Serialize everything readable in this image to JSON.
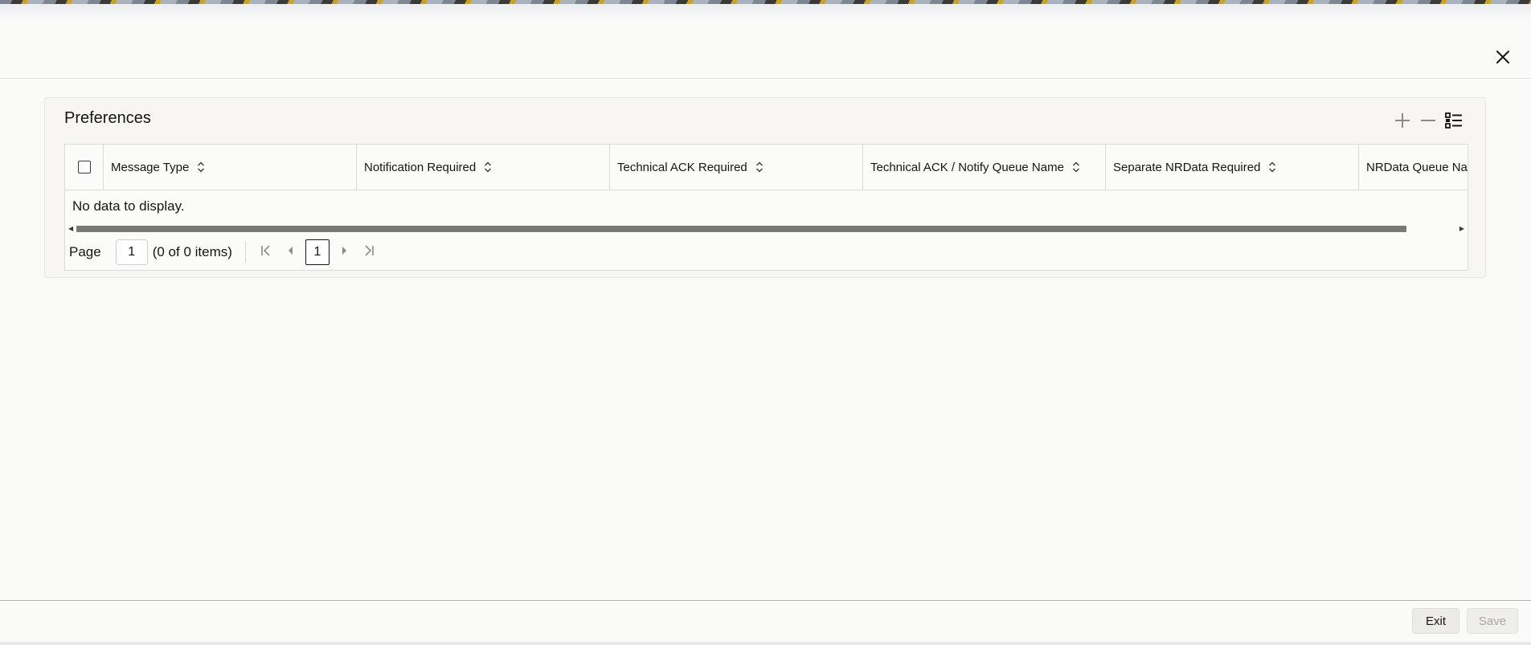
{
  "header": {
    "close_icon": "close-icon"
  },
  "panel": {
    "title": "Preferences",
    "toolbar": {
      "add_icon": "plus-icon",
      "remove_icon": "minus-icon",
      "columns_icon": "list-columns-icon"
    },
    "table": {
      "columns": [
        "Message Type",
        "Notification Required",
        "Technical ACK Required",
        "Technical ACK / Notify Queue Name",
        "Separate NRData Required",
        "NRData Queue Nar"
      ],
      "empty_message": "No data to display."
    },
    "pagination": {
      "page_label": "Page",
      "page_value": "1",
      "items_text": "(0 of 0 items)",
      "current_page": "1"
    }
  },
  "footer": {
    "exit_label": "Exit",
    "save_label": "Save"
  },
  "colors": {
    "background": "#fafaf9",
    "text": "#161513",
    "scroll_thumb": "#7a7976",
    "disabled_text": "#a9a7a4"
  }
}
